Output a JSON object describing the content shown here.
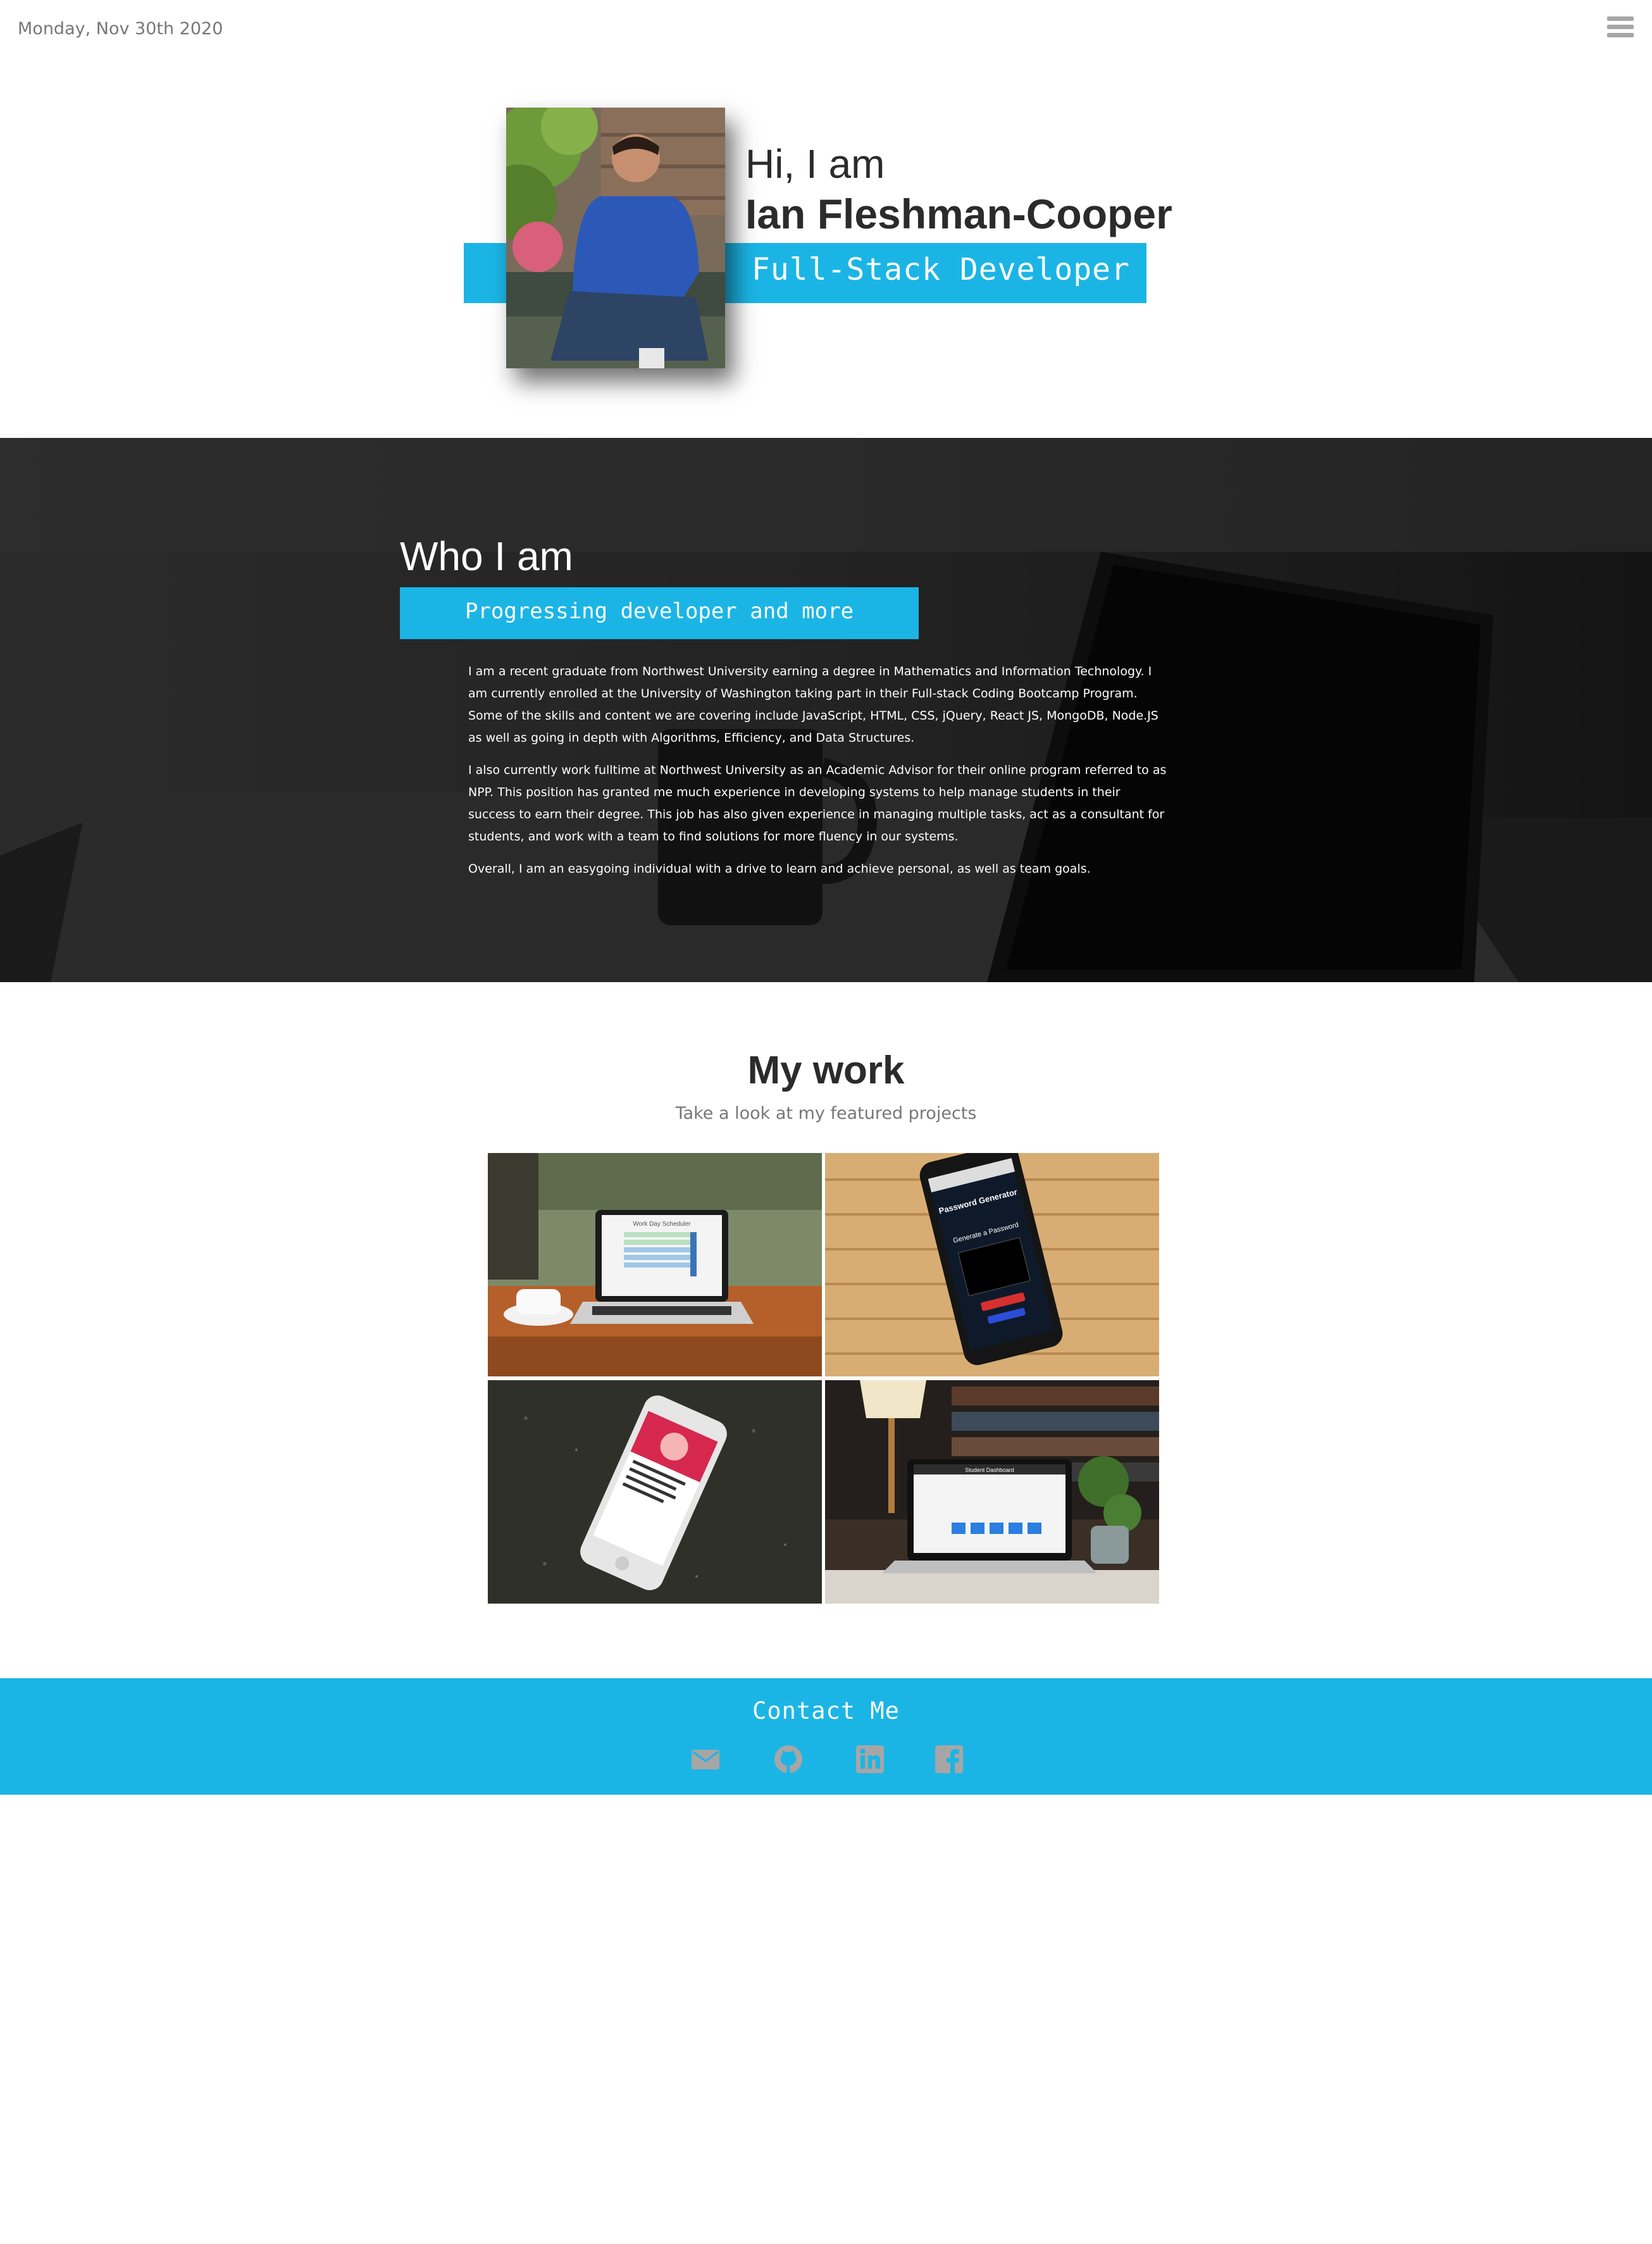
{
  "header": {
    "date": "Monday, Nov 30th 2020",
    "menu_icon": "hamburger-menu-icon"
  },
  "hero": {
    "greeting": "Hi, I am",
    "name": "Ian Fleshman-Cooper",
    "role": "Full-Stack Developer"
  },
  "about": {
    "title": "Who I am",
    "subtitle": "Progressing developer and more",
    "paragraphs": [
      "I am a recent graduate from Northwest University earning a degree in Mathematics and Information Technology. I am currently enrolled at the University of Washington taking part in their Full-stack Coding Bootcamp Program. Some of the skills and content we are covering include JavaScript, HTML, CSS, jQuery, React JS, MongoDB, Node.JS as well as going in depth with Algorithms, Efficiency, and Data Structures.",
      "I also currently work fulltime at Northwest University as an Academic Advisor for their online program referred to as NPP. This position has granted me much experience in developing systems to help manage students in their success to earn their degree. This job has also given experience in managing multiple tasks, act as a consultant for students, and work with a team to find solutions for more fluency in our systems.",
      "Overall, I am an easygoing individual with a drive to learn and achieve personal, as well as team goals."
    ]
  },
  "work": {
    "title": "My work",
    "subtitle": "Take a look at my featured projects",
    "projects": [
      {
        "screen_title": "Work Day Scheduler"
      },
      {
        "screen_title": "Password Generator",
        "screen_subtitle": "Generate a Password"
      },
      {
        "screen_title": ""
      },
      {
        "screen_title": "Student Dashboard"
      }
    ]
  },
  "contact": {
    "title": "Contact Me",
    "links": [
      "email-icon",
      "github-icon",
      "linkedin-icon",
      "facebook-icon"
    ]
  },
  "colors": {
    "accent": "#1bb5e5",
    "text": "#2b2b2b",
    "muted": "#777777",
    "icon_gray": "#a6a6a6"
  }
}
